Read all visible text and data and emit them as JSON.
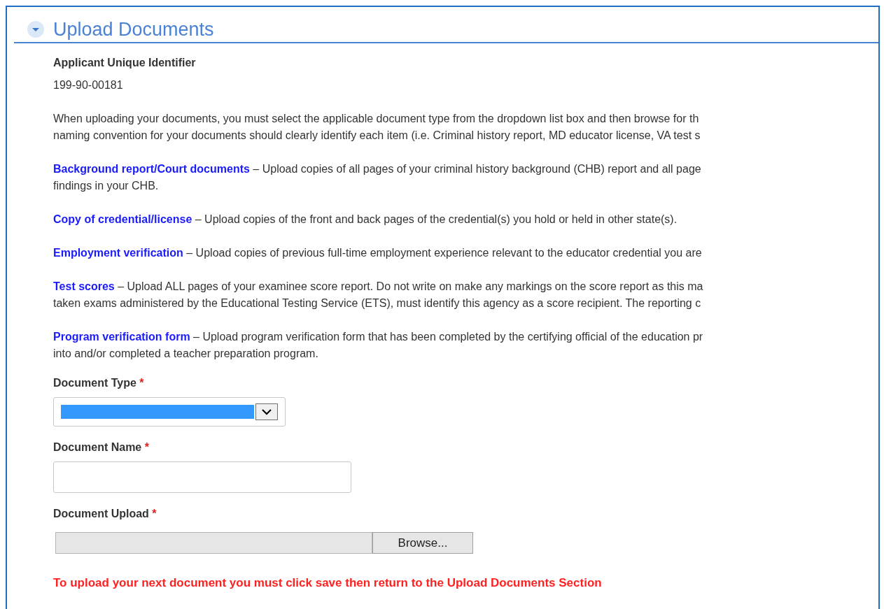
{
  "section": {
    "title": "Upload Documents",
    "expanded": true
  },
  "identifier": {
    "label": "Applicant Unique Identifier",
    "value": "199-90-00181"
  },
  "intro": [
    "When uploading your documents, you must select the applicable document type from the dropdown list box  and then browse for th",
    "naming convention for your documents should clearly identify each item (i.e. Criminal history report, MD educator license, VA test s"
  ],
  "items": [
    {
      "link": "Background report/Court documents",
      "lines": [
        " – Upload copies of all pages of your criminal history background (CHB) report and all page",
        "findings in your CHB."
      ]
    },
    {
      "link": "Copy of credential/license",
      "lines": [
        " – Upload copies of the front and back pages of the credential(s) you hold or held in other state(s)."
      ]
    },
    {
      "link": "Employment verification",
      "lines": [
        " – Upload copies of previous full-time employment experience relevant to the educator credential you are"
      ]
    },
    {
      "link": "Test scores",
      "lines": [
        " – Upload ALL pages of your examinee score report. Do not write on make any markings on the score report as this ma",
        "taken exams administered by the Educational Testing Service (ETS), must identify this agency as a score recipient. The reporting c"
      ]
    },
    {
      "link": "Program verification form",
      "lines": [
        " – Upload program verification form that has been completed by the certifying official of the education pr",
        "into and/or completed a teacher preparation program."
      ]
    }
  ],
  "fields": [
    {
      "kind": "select",
      "label": "Document Type",
      "marker": "*",
      "highlighted": true
    },
    {
      "kind": "text",
      "label": "Document Name",
      "marker": "*"
    },
    {
      "kind": "file",
      "label": "Document Upload",
      "marker": "*",
      "button": "Browse..."
    }
  ],
  "notice": "To upload your next document you must click save then return to the Upload Documents Section"
}
